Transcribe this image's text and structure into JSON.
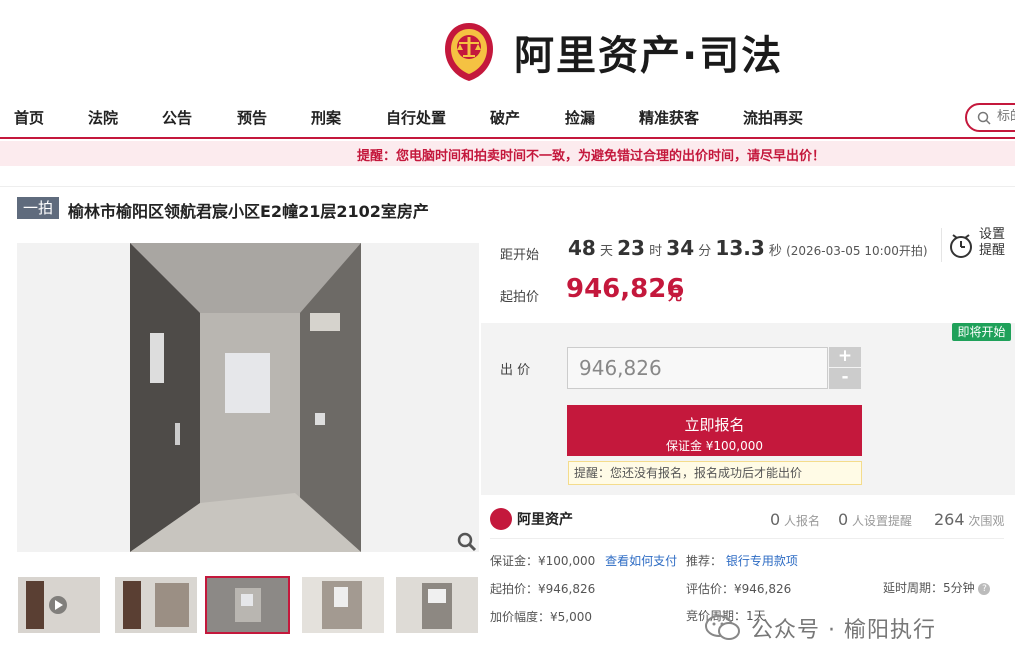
{
  "header": {
    "logo_text": "阿里资产·司法",
    "nav": [
      "首页",
      "法院",
      "公告",
      "预告",
      "刑案",
      "自行处置",
      "破产",
      "捡漏",
      "精准获客",
      "流拍再买"
    ],
    "search_placeholder": "标的"
  },
  "warning": "提醒：您电脑时间和拍卖时间不一致，为避免错过合理的出价时间，请尽早出价！",
  "item": {
    "tag": "一拍",
    "title": "榆林市榆阳区领航君宸小区E2幢21层2102室房产"
  },
  "auction": {
    "countdown_label": "距开始",
    "days": "48",
    "days_unit": "天",
    "hours": "23",
    "hours_unit": "时",
    "minutes": "34",
    "minutes_unit": "分",
    "seconds": "13.3",
    "seconds_unit": "秒",
    "start_time": "(2026-03-05 10:00开拍)",
    "remind_label": "设置\n提醒",
    "start_price_label": "起拍价",
    "start_price": "946,826",
    "start_price_unit": "元",
    "status_badge": "即将开始",
    "bid_label": "出 价",
    "bid_value": "946,826",
    "plus": "+",
    "minus": "-",
    "signup_label": "立即报名",
    "deposit_line": "保证金 ¥100,000",
    "tip": "提醒：您还没有报名，报名成功后才能出价"
  },
  "stats": {
    "brand": "阿里资产",
    "signups": "0",
    "signups_label": "人报名",
    "reminders": "0",
    "reminders_label": "人设置提醒",
    "views": "264",
    "views_label": "次围观"
  },
  "details": {
    "deposit": "保证金：¥100,000",
    "how_to_pay": "查看如何支付",
    "recommend_label": "推荐：",
    "recommend_link": "银行专用款项",
    "start_price": "起拍价：¥946,826",
    "appraisal": "评估价：¥946,826",
    "delay": "延时周期：5分钟",
    "increment": "加价幅度：¥5,000",
    "cycle": "竞价周期：1天"
  },
  "watermark": "公众号 · 榆阳执行",
  "colors": {
    "accent": "#c4183c",
    "badge": "#1fa15a",
    "link": "#2e6cc4"
  }
}
